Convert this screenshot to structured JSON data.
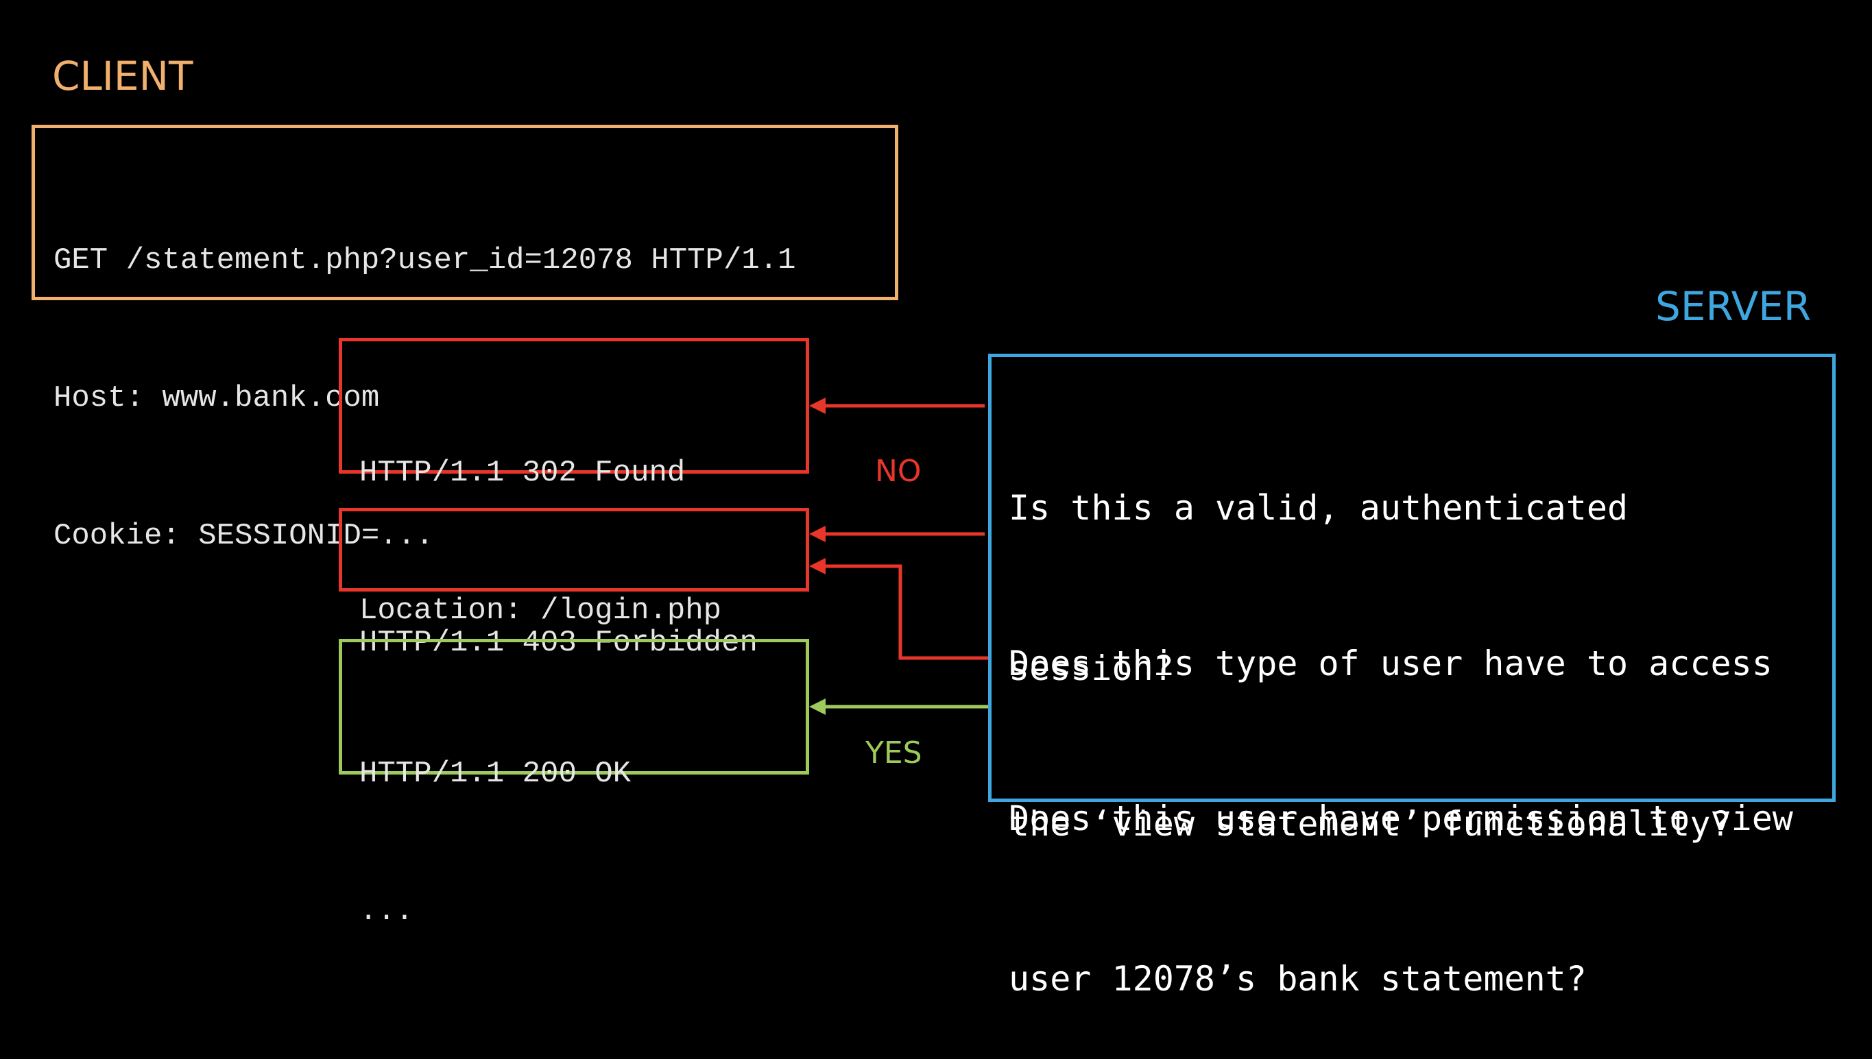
{
  "colors": {
    "background": "#000000",
    "client": "#f2b06e",
    "server": "#3fa7e0",
    "deny": "#e8362a",
    "allow": "#9dca5a",
    "text": "#e6e6e6"
  },
  "client": {
    "label": "CLIENT",
    "request_lines": [
      "GET /statement.php?user_id=12078 HTTP/1.1",
      "Host: www.bank.com",
      "Cookie: SESSIONID=..."
    ]
  },
  "server": {
    "label": "SERVER",
    "questions": [
      {
        "lines": [
          "Is this a valid, authenticated",
          "session?"
        ]
      },
      {
        "lines": [
          "Does this type of user have to access",
          "the ‘view statement’ functionality?"
        ]
      },
      {
        "lines": [
          "Does this user have permission to view",
          "user 12078’s bank statement?"
        ]
      }
    ]
  },
  "responses": [
    {
      "lines": [
        "HTTP/1.1 302 Found",
        "Location: /login.php"
      ],
      "kind": "deny"
    },
    {
      "lines": [
        "HTTP/1.1 403 Forbidden"
      ],
      "kind": "deny"
    },
    {
      "lines": [
        "HTTP/1.1 200 OK",
        "..."
      ],
      "kind": "allow"
    }
  ],
  "edge_labels": {
    "no": "NO",
    "yes": "YES"
  }
}
